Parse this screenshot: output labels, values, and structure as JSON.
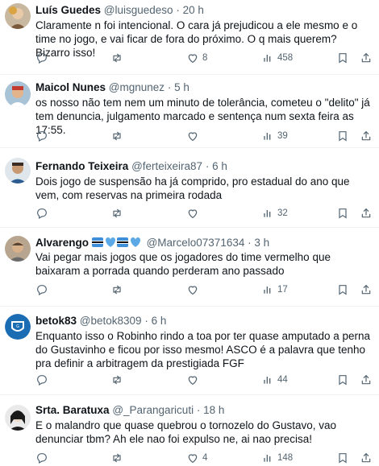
{
  "tweets": [
    {
      "name": "Luís Guedes",
      "handle": "@luisguedeso",
      "time": "20 h",
      "text": "Claramente n foi intencional. O cara já prejudicou a ele mesmo e o time no jogo, e vai ficar de fora do próximo. O q mais querem? Bizarro isso!",
      "replies": "",
      "retweets": "",
      "likes": "8",
      "views": "458"
    },
    {
      "name": "Maicol Nunes",
      "handle": "@mgnunez",
      "time": "5 h",
      "text": "os nosso não tem nem um minuto de tolerância, cometeu o \"delito\" já tem denuncia, julgamento marcado e sentença num sexta feira as 17:55.",
      "replies": "",
      "retweets": "",
      "likes": "",
      "views": "39"
    },
    {
      "name": "Fernando Teixeira",
      "handle": "@ferteixeira87",
      "time": "6 h",
      "text": "Dois jogo de suspensão ha já comprido, pro estadual do ano que vem, com reservas na primeira rodada",
      "replies": "",
      "retweets": "",
      "likes": "",
      "views": "32"
    },
    {
      "name": "Alvarengo",
      "handle": "@Marcelo07371634",
      "time": "3 h",
      "text": "Vai pegar mais jogos que os jogadores do time vermelho que baixaram a porrada quando perderam ano passado",
      "replies": "",
      "retweets": "",
      "likes": "",
      "views": "17"
    },
    {
      "name": "betok83",
      "handle": "@betok8309",
      "time": "6 h",
      "text": "Enquanto isso o Robinho rindo a toa por ter quase amputado a perna do Gustavinho e ficou por isso mesmo! ASCO é a palavra que tenho pra definir a arbitragem da prestigiada FGF",
      "replies": "",
      "retweets": "",
      "likes": "",
      "views": "44"
    },
    {
      "name": "Srta. Baratuxa",
      "handle": "@_Parangaricuti",
      "time": "18 h",
      "text": "E o malandro que quase quebrou o tornozelo do Gustavo, vao denunciar tbm? Ah ele nao foi expulso ne, ai nao precisa!",
      "replies": "",
      "retweets": "",
      "likes": "4",
      "views": "148"
    }
  ],
  "colors": {
    "text": "#0f1419",
    "secondary": "#536471",
    "divider": "#eff3f4",
    "grey_icon": "#536471"
  },
  "icons": {
    "reply": "reply-icon",
    "retweet": "retweet-icon",
    "like": "like-icon",
    "views": "views-icon",
    "bookmark": "bookmark-icon",
    "share": "share-icon"
  }
}
